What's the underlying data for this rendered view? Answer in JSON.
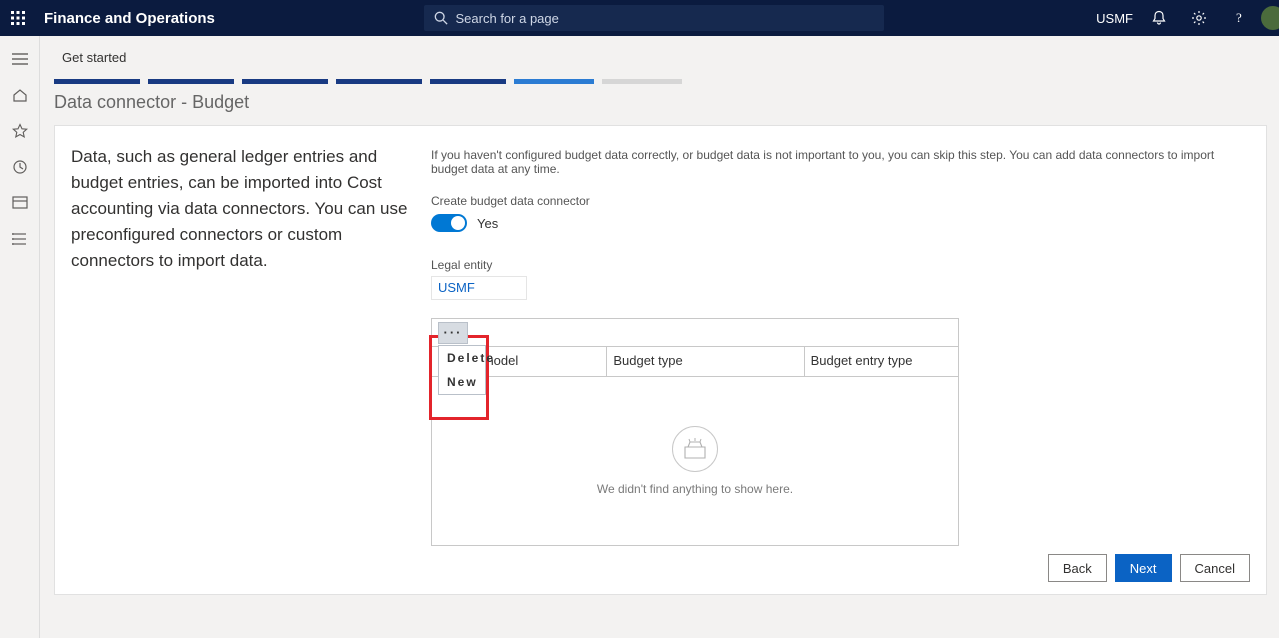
{
  "header": {
    "product": "Finance and Operations",
    "search_placeholder": "Search for a page",
    "company": "USMF"
  },
  "breadcrumb": "Get started",
  "step_title": "Data connector - Budget",
  "intro": "Data, such as general ledger entries and budget entries, can be imported into Cost accounting via data connectors. You can use preconfigured connectors or custom connectors to import data.",
  "helper": "If you haven't configured budget data correctly, or budget data is not important to you, you can skip this step. You can add data connectors to import budget data at any time.",
  "form": {
    "create_label": "Create budget data connector",
    "toggle_value": "Yes",
    "legal_entity_label": "Legal entity",
    "legal_entity_value": "USMF"
  },
  "grid": {
    "columns": [
      "Budget model",
      "Budget type",
      "Budget entry type"
    ],
    "empty_text": "We didn't find anything to show here.",
    "menu": {
      "delete": "Delete",
      "new": "New"
    }
  },
  "footer": {
    "back": "Back",
    "next": "Next",
    "cancel": "Cancel"
  }
}
